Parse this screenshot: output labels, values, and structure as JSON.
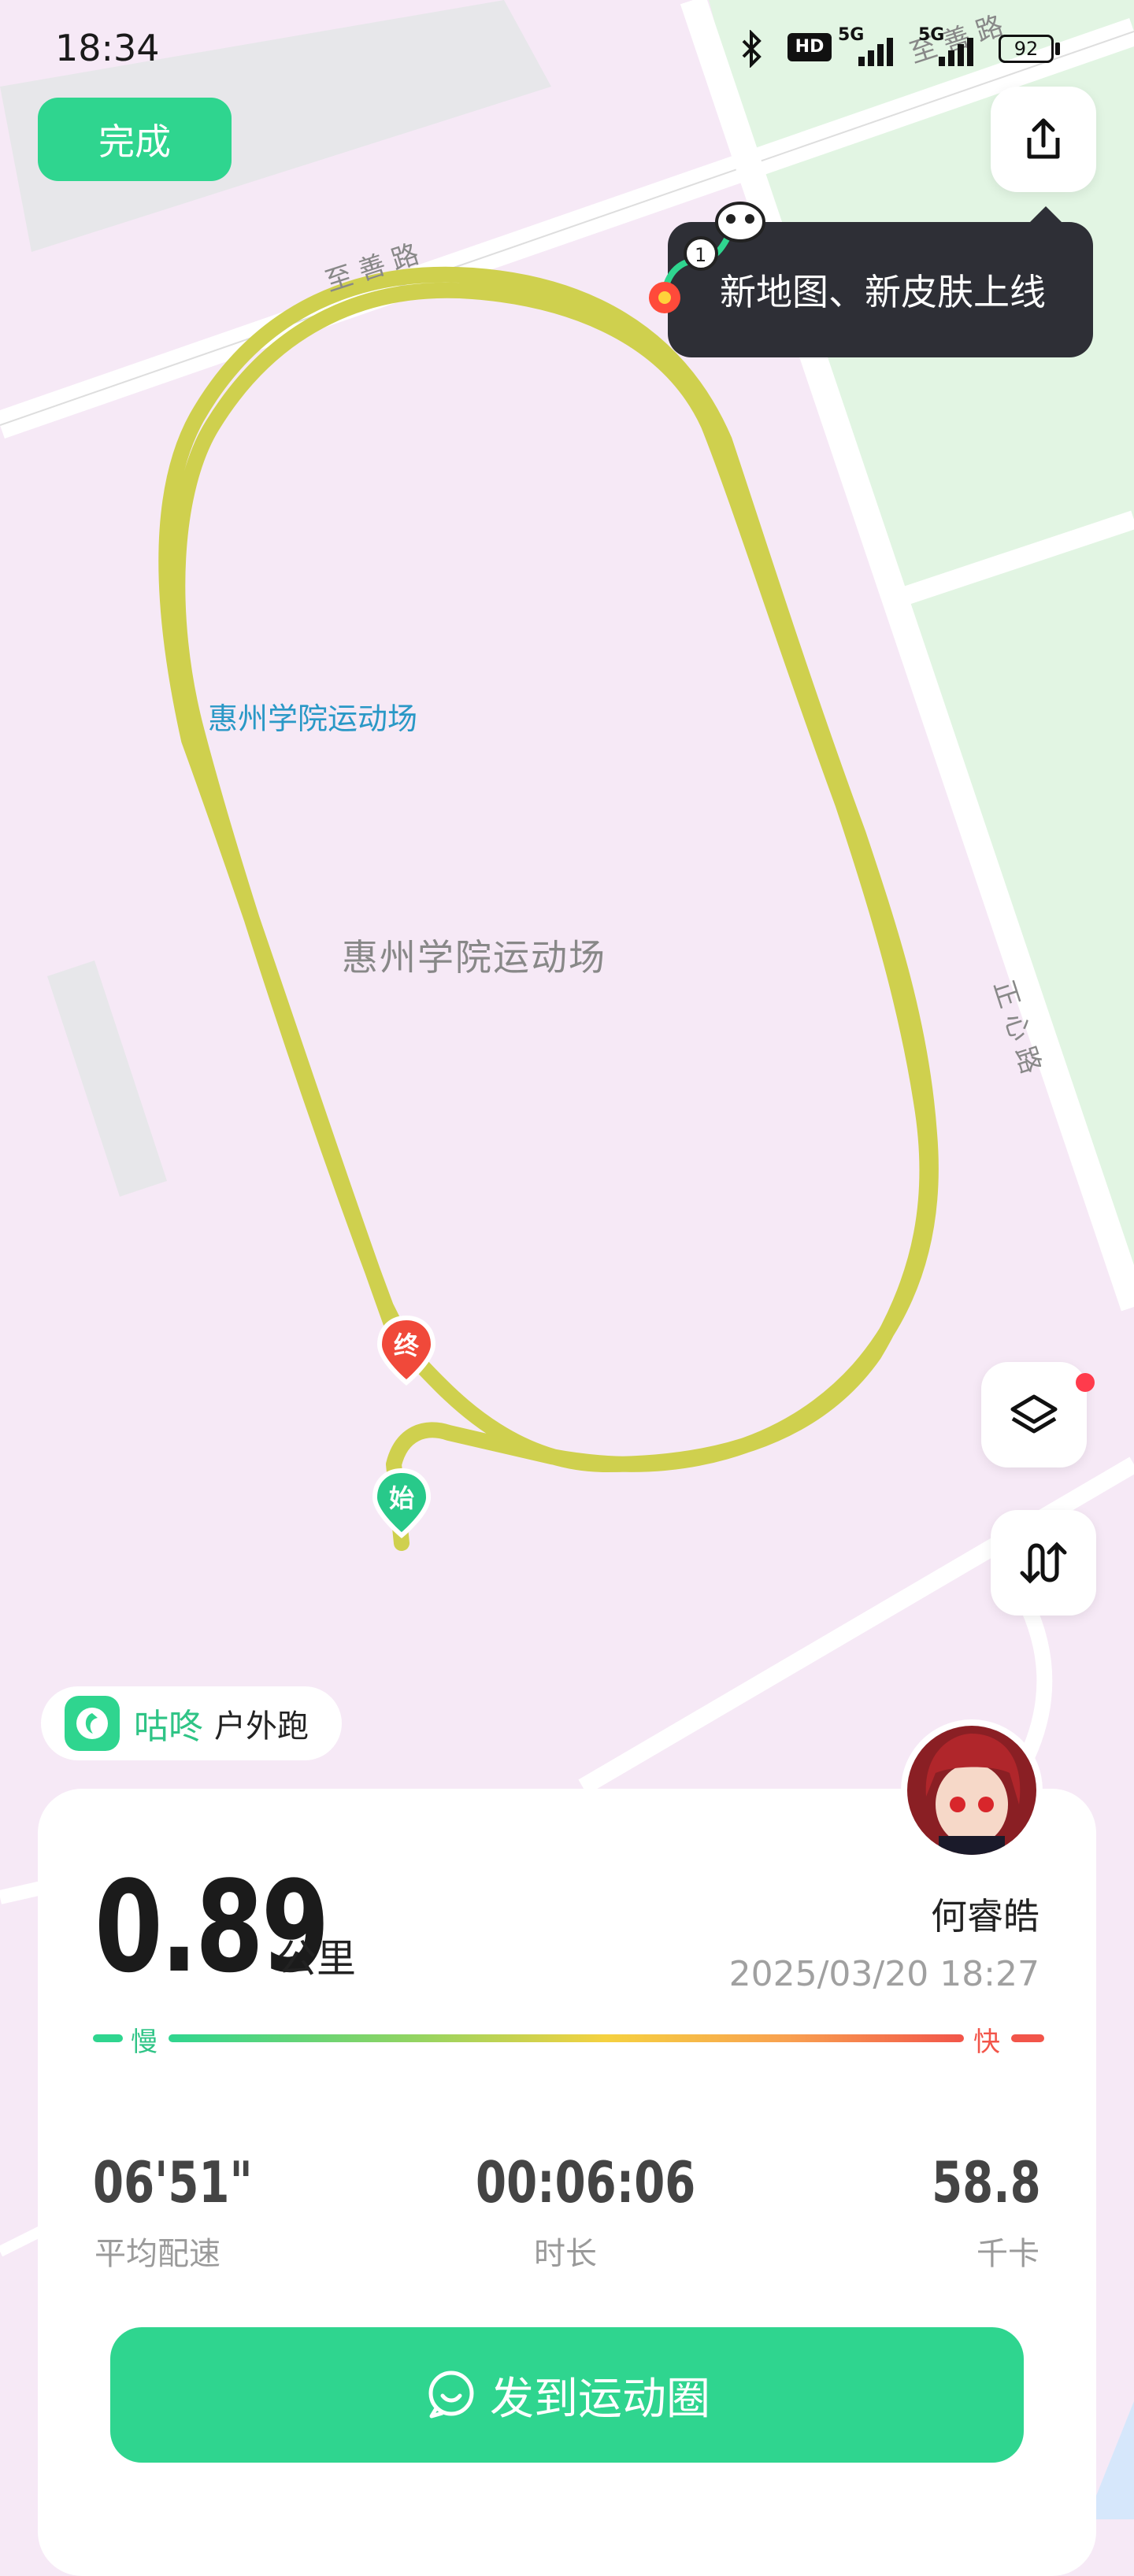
{
  "status_bar": {
    "time": "18:34",
    "icons": [
      "bluetooth-icon",
      "hd-icon",
      "signal-5g-icon",
      "signal-5g-icon"
    ],
    "network_1": "5G",
    "network_2": "5G",
    "battery": "92"
  },
  "header": {
    "done_label": "完成",
    "tooltip_text": "新地图、新皮肤上线"
  },
  "map": {
    "road_top": "至善路",
    "road_top_right": "至善路",
    "road_right": "正心路",
    "venue_label": "惠州学院运动场",
    "venue_center_label": "惠州学院运动场",
    "start_marker": "始",
    "end_marker": "终",
    "route_color": "#cfd04e"
  },
  "brand": {
    "name": "咕咚",
    "activity": "户外跑"
  },
  "summary": {
    "distance": "0.89",
    "distance_unit": "公里",
    "user_name": "何睿皓",
    "datetime": "2025/03/20 18:27",
    "pace_slow": "慢",
    "pace_fast": "快",
    "stats": [
      {
        "value": "06'51\"",
        "label": "平均配速"
      },
      {
        "value": "00:06:06",
        "label": "时长"
      },
      {
        "value": "58.8",
        "label": "千卡"
      }
    ]
  },
  "footer": {
    "send_label": "发到运动圈"
  },
  "colors": {
    "accent": "#2fd58f",
    "slow": "#2fd58f",
    "fast": "#f2554a",
    "end_marker": "#f0493a",
    "start_marker": "#28c98a"
  }
}
